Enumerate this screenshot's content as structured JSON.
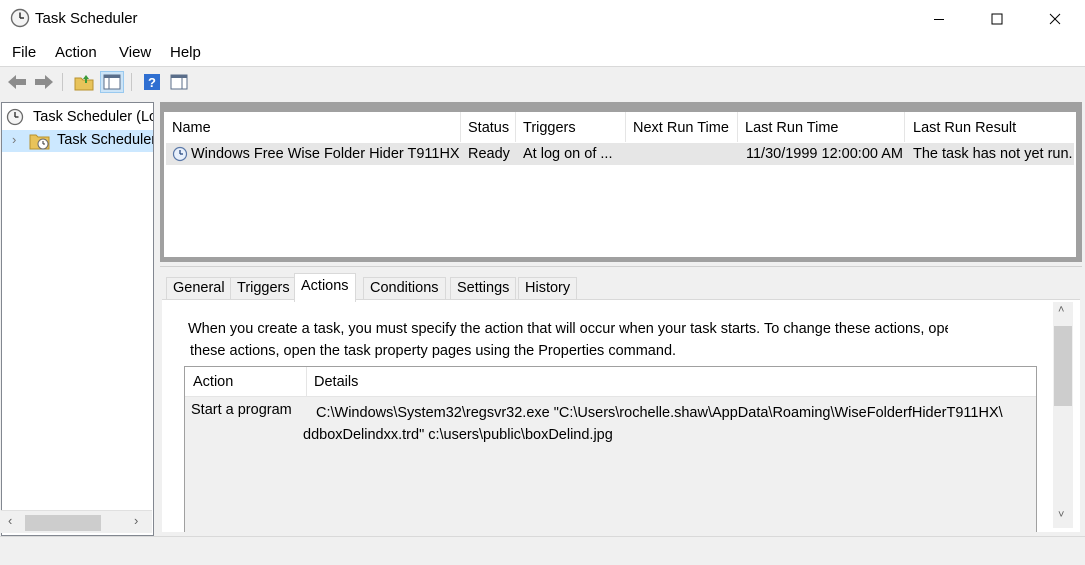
{
  "window": {
    "title": "Task Scheduler"
  },
  "menu": [
    "File",
    "Action",
    "View",
    "Help"
  ],
  "tree": {
    "root_label": "Task Scheduler (Local)",
    "child_label": "Task Scheduler Library",
    "expand_glyph": "›"
  },
  "task_list": {
    "columns": [
      "Name",
      "Status",
      "Triggers",
      "Next Run Time",
      "Last Run Time",
      "Last Run Result"
    ],
    "rows": [
      {
        "name": "Windows Free Wise Folder Hider T911HX",
        "status": "Ready",
        "triggers": "At log on of ...",
        "next_run_time": "",
        "last_run_time": "11/30/1999 12:00:00 AM",
        "last_run_result": "The task has not yet run."
      }
    ]
  },
  "tabs": {
    "items": [
      "General",
      "Triggers",
      "Actions",
      "Conditions",
      "Settings",
      "History"
    ],
    "active": "Actions"
  },
  "actions_tab": {
    "description_line1": "When you create a task, you must specify the action that will occur when your task starts.  To change these actions, open the task property pages using the Properties command.",
    "description_line2": "these actions, open the task property pages using the Properties command.",
    "columns": [
      "Action",
      "Details"
    ],
    "rows": [
      {
        "action": "Start a program",
        "details_line1": "C:\\Windows\\System32\\regsvr32.exe \"C:\\Users\\rochelle.shaw\\AppData\\Roaming\\WiseFolderfHiderT911HX\\",
        "details_line2": "ddboxDelindxx.trd\" c:\\users\\public\\boxDelind.jpg"
      }
    ]
  },
  "colors": {
    "selected_row": "#e6e6e6",
    "panel_frame": "#a0a0a0",
    "window_bg": "#f0f0f0"
  }
}
